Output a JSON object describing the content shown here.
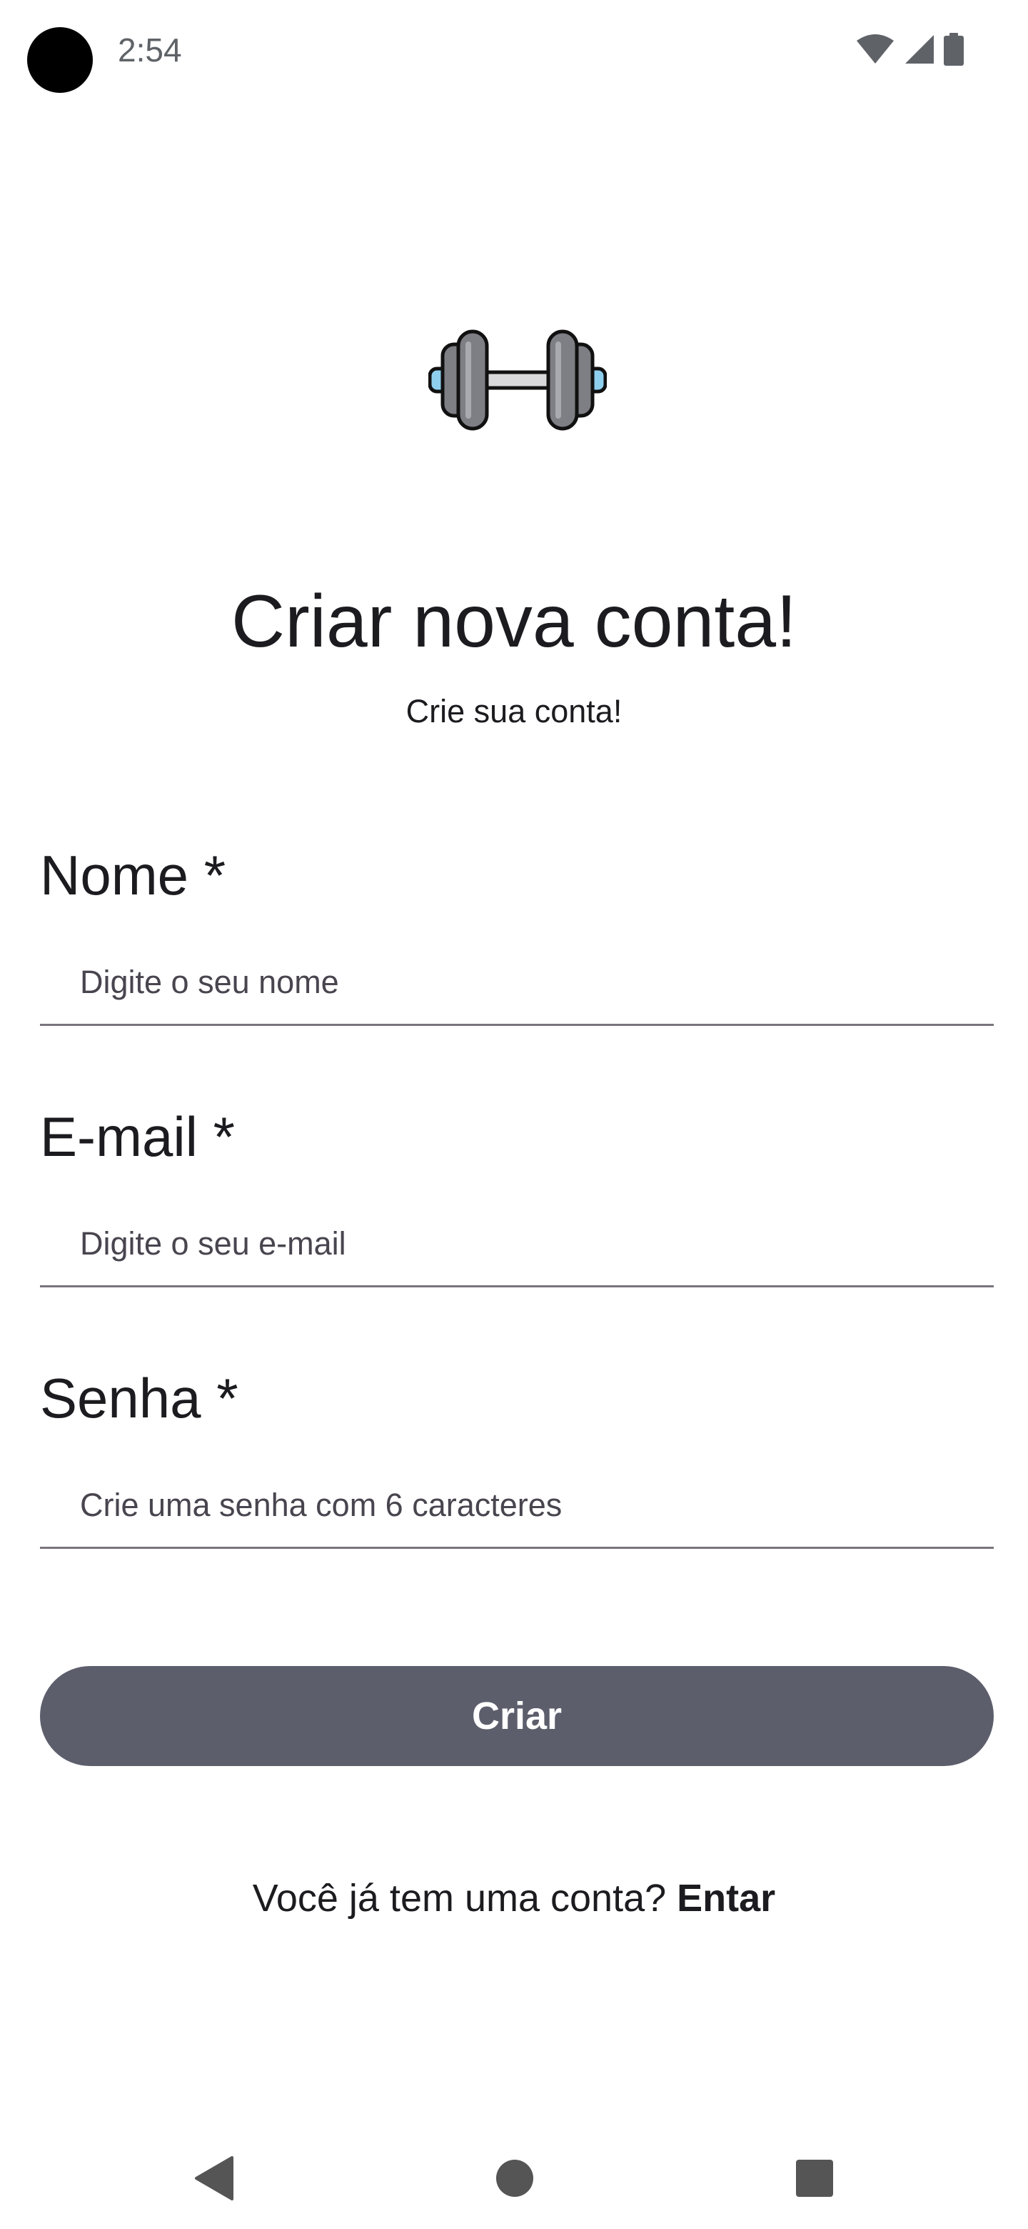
{
  "status_bar": {
    "time": "2:54",
    "icons": [
      "wifi-icon",
      "cellular-signal-icon",
      "battery-icon"
    ]
  },
  "logo": {
    "icon": "dumbbell-icon"
  },
  "header": {
    "title": "Criar nova conta!",
    "subtitle": "Crie sua conta!"
  },
  "form": {
    "name": {
      "label": "Nome *",
      "placeholder": "Digite o seu nome",
      "value": ""
    },
    "email": {
      "label": "E-mail *",
      "placeholder": "Digite o seu e-mail",
      "value": ""
    },
    "password": {
      "label": "Senha *",
      "placeholder": "Crie uma senha com 6 caracteres",
      "value": ""
    },
    "submit_label": "Criar"
  },
  "footer": {
    "prompt": "Você já tem uma conta? ",
    "link_label": "Entar"
  },
  "navigation": {
    "icons": [
      "back-icon",
      "home-icon",
      "recent-apps-icon"
    ]
  },
  "colors": {
    "button_background": "#5c5e6c",
    "button_text": "#ffffff",
    "text": "#1c1b1f",
    "field_underline": "#79747e",
    "logo_plate": "#7e7f85",
    "logo_accent": "#8fcfee"
  }
}
